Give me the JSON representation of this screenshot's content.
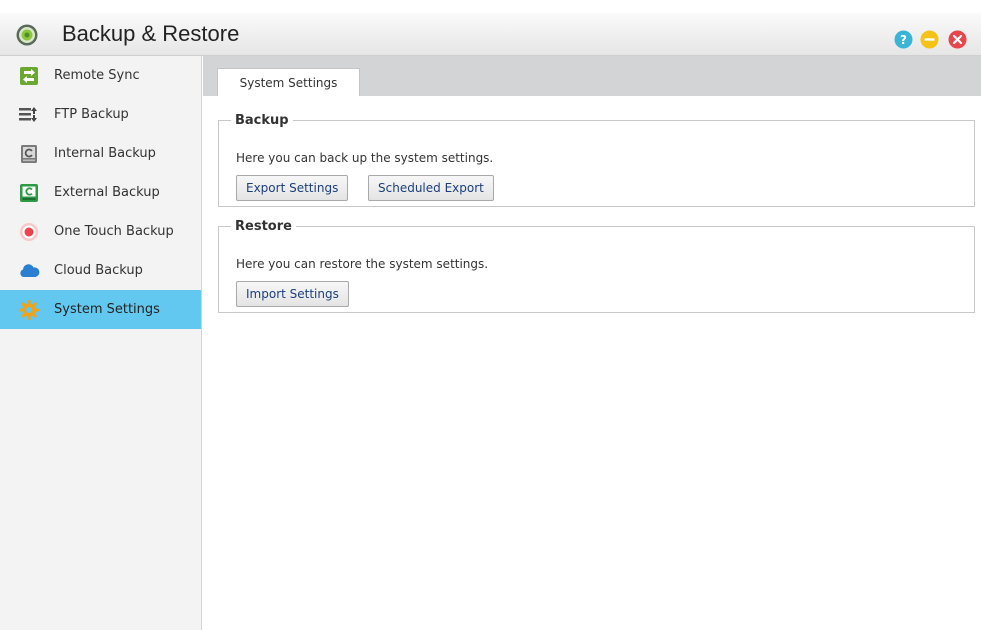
{
  "window": {
    "title": "Backup & Restore",
    "icons": [
      "app-logo-icon",
      "help-icon",
      "minimize-icon",
      "close-icon"
    ]
  },
  "sidebar": {
    "items": [
      {
        "label": "Remote Sync",
        "icon": "remote-sync-icon"
      },
      {
        "label": "FTP Backup",
        "icon": "ftp-backup-icon"
      },
      {
        "label": "Internal Backup",
        "icon": "internal-backup-icon"
      },
      {
        "label": "External Backup",
        "icon": "external-backup-icon"
      },
      {
        "label": "One Touch Backup",
        "icon": "one-touch-backup-icon"
      },
      {
        "label": "Cloud Backup",
        "icon": "cloud-backup-icon"
      },
      {
        "label": "System Settings",
        "icon": "system-settings-icon",
        "active": true
      }
    ]
  },
  "tabs": [
    {
      "label": "System Settings",
      "active": true
    }
  ],
  "backup": {
    "title": "Backup",
    "description": "Here you can back up the system settings.",
    "export_label": "Export Settings",
    "scheduled_label": "Scheduled Export"
  },
  "restore": {
    "title": "Restore",
    "description": "Here you can restore the system settings.",
    "import_label": "Import Settings"
  },
  "colors": {
    "active_nav": "#63c8ef",
    "tabbar": "#d2d4d6",
    "button_text": "#1c3f7a",
    "help_button": "#3bb4d8",
    "minimize_button": "#f5c218",
    "close_button": "#e8454d"
  }
}
